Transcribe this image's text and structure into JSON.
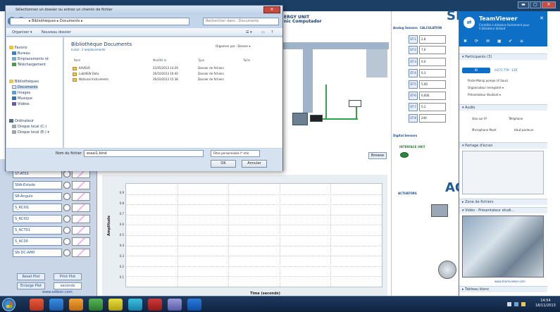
{
  "dialog": {
    "title": "Sélectionnez un dossier ou entrez un chemin de fichier",
    "address": "▸ Bibliothèques ▸ Documents ▸",
    "search_placeholder": "Rechercher dans : Documents",
    "toolbar_organize": "Organiser ▾",
    "toolbar_new_folder": "Nouveau dossier",
    "nav": [
      {
        "label": "Favoris",
        "icon": "star-icon"
      },
      {
        "label": "Bureau",
        "icon": "desktop-icon"
      },
      {
        "label": "Emplacements ré",
        "icon": "recent-icon"
      },
      {
        "label": "Téléchargement",
        "icon": "download-icon"
      },
      {
        "label": "Bibliothèques",
        "icon": "library-icon"
      },
      {
        "label": "Documents",
        "icon": "documents-icon"
      },
      {
        "label": "Images",
        "icon": "images-icon"
      },
      {
        "label": "Musique",
        "icon": "music-icon"
      },
      {
        "label": "Vidéos",
        "icon": "video-icon"
      },
      {
        "label": "Ordinateur",
        "icon": "computer-icon"
      },
      {
        "label": "Disque local (C:)",
        "icon": "drive-icon"
      },
      {
        "label": "Disque local (E:) ▾",
        "icon": "drive-icon"
      }
    ],
    "library_title": "Bibliothèque Documents",
    "library_subtitle": "Inclut : 2 emplacements",
    "arrange_by": "Organiser par : Dossier ▾",
    "columns": [
      "Nom",
      "Modifié le",
      "Type",
      "Taille"
    ],
    "files": [
      {
        "name": "KAVEUR",
        "modified": "22/05/2013 14:29",
        "type": "Dossier de fichiers",
        "size": ""
      },
      {
        "name": "LabVIEW Data",
        "modified": "26/10/2013 16:40",
        "type": "Dossier de fichiers",
        "size": ""
      },
      {
        "name": "National Instruments",
        "modified": "26/10/2013 15:38",
        "type": "Dossier de fichiers",
        "size": ""
      }
    ],
    "filename_label": "Nom du fichier :",
    "filename_value": "essai1.bind",
    "filter_value": "Filtre personnalisé (*.nfo)",
    "ok_label": "OK",
    "cancel_label": "Annuler"
  },
  "app": {
    "diagram_title_1": "ERGY UNIT",
    "diagram_title_2": "nic Computador",
    "browse_label": "Browse",
    "analog_tab": "Analog Sensors",
    "calc_tab": "CALCULATION",
    "digital_tab": "Digital Sensors",
    "interface_unit": "INTERFACE UNIT",
    "actuators_tab": "ACTUATORS",
    "big_letter_1": "SI",
    "big_letter_2": "AC",
    "sensors": [
      {
        "label": "ST-1",
        "value": "2,8"
      },
      {
        "label": "ST-2",
        "value": "7,6"
      },
      {
        "label": "ST-3",
        "value": "0,0"
      },
      {
        "label": "ST-4",
        "value": "0,3"
      },
      {
        "label": "ST-5",
        "value": "5,00"
      },
      {
        "label": "ST-6",
        "value": "0,000"
      },
      {
        "label": "ST-7",
        "value": "0,2"
      },
      {
        "label": "ST-8",
        "value": "240"
      }
    ],
    "signals": [
      "ST-AT01",
      "SNA-Estado",
      "SR-Ángulo",
      "S_RCI01",
      "S_RCI02",
      "S_ACT01",
      "S_AC00",
      "SN DC-AM0"
    ],
    "reset_plot": "Reset Plot",
    "print_plot": "Print Plot",
    "enlarge_plot": "Enlarge Plot",
    "seconds": "seconds",
    "footer_url": "www.edibon.com",
    "y_axis_label": "Amplitude",
    "x_axis_label": "Time (seconds)",
    "y_ticks": [
      "0.9",
      "0.8",
      "0.7",
      "0.6",
      "0.5",
      "0.4",
      "0.3",
      "0.2",
      "0.1"
    ]
  },
  "teamviewer": {
    "name": "TeamViewer",
    "tagline": "Contrôle à distance facilement pour l'utilisateur distant",
    "participants_header": "▾ Participants (3)",
    "session_id": "ID",
    "session_number": "m271 779 - 129",
    "participants": [
      "Poste-Manip pompe (4 Sous)",
      "Organisateur enregistré ▾",
      "Présentateur étudiant ▾"
    ],
    "audio_header": "▾ Audio",
    "voice_ip": "Voix sur IP",
    "phone": "Téléphone",
    "mic_muted": "Microphone Muet",
    "speakers": "Haut-parleurs",
    "screen_share_header": "▾ Partage d'écran",
    "files_header": "▸ Zone de fichiers",
    "video_header": "▾ Vidéo - Présentateur étudi...",
    "url": "www.teamviewer.com",
    "whiteboard_header": "▸ Tableau blanc"
  },
  "taskbar": {
    "time": "14:54",
    "date": "18/11/2013"
  },
  "colors": {
    "teamviewer_blue": "#0e6fc7",
    "dialog_bg": "#c3d5ea",
    "taskbar": "#0f2340"
  }
}
